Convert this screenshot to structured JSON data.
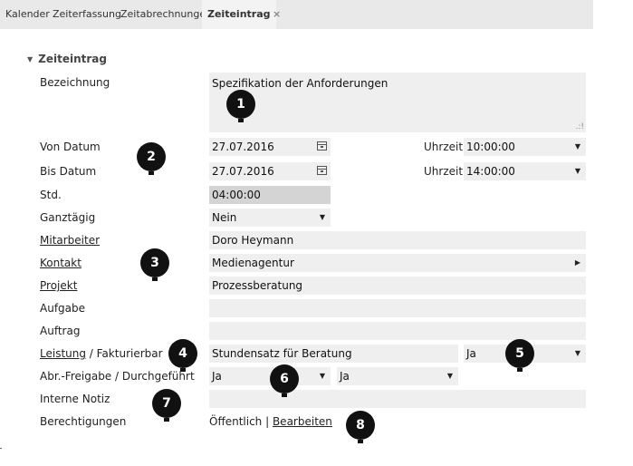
{
  "tabs": [
    {
      "label": "Kalender"
    },
    {
      "label": "Zeiterfassung"
    },
    {
      "label": "Zeitabrechnungen"
    },
    {
      "label": "Zeiteintrag"
    }
  ],
  "tab_close": "×",
  "section": {
    "title": "Zeiteintrag",
    "caret": "▼"
  },
  "labels": {
    "bezeichnung": "Bezeichnung",
    "von_datum": "Von Datum",
    "bis_datum": "Bis Datum",
    "std": "Std.",
    "ganztaegig": "Ganztägig",
    "mitarbeiter": "Mitarbeiter",
    "kontakt": "Kontakt",
    "projekt": "Projekt",
    "aufgabe": "Aufgabe",
    "auftrag": "Auftrag",
    "leistung": "Leistung",
    "fakturierbar": " / Fakturierbar",
    "abr_freigabe": "Abr.-Freigabe / Durchgeführt",
    "interne_notiz": "Interne Notiz",
    "berechtigungen": "Berechtigungen",
    "uhrzeit": "Uhrzeit"
  },
  "values": {
    "bezeichnung": "Spezifikation der Anforderungen",
    "von_datum": "27.07.2016",
    "von_uhrzeit": "10:00:00",
    "bis_datum": "27.07.2016",
    "bis_uhrzeit": "14:00:00",
    "std": "04:00:00",
    "ganztaegig": "Nein",
    "mitarbeiter": "Doro Heymann",
    "kontakt": "Medienagentur",
    "projekt": "Prozessberatung",
    "aufgabe": "",
    "auftrag": "",
    "leistung": "Stundensatz für Beratung",
    "fakturierbar": "Ja",
    "abr_freigabe": "Ja",
    "durchgefuehrt": "Ja",
    "interne_notiz": "",
    "berechtigungen_text": "Öffentlich | ",
    "berechtigungen_link": "Bearbeiten"
  },
  "glyphs": {
    "dropdown": "▼",
    "arrow_right": "▶",
    "grip": ".:!"
  },
  "markers": [
    "1",
    "2",
    "3",
    "4",
    "5",
    "6",
    "7",
    "8"
  ]
}
